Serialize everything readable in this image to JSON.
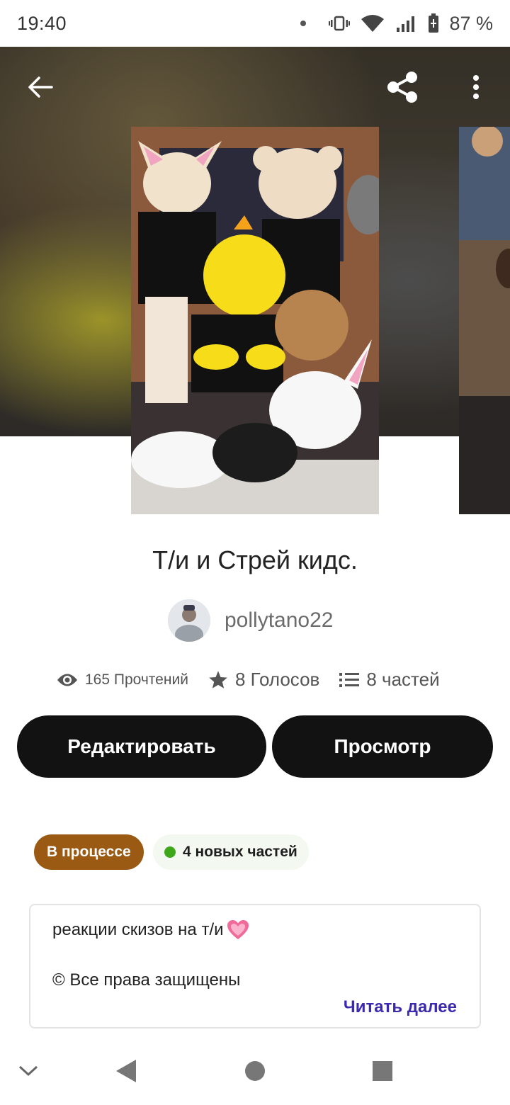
{
  "status_bar": {
    "time": "19:40",
    "battery": "87 %"
  },
  "header": {
    "back_icon": "arrow-left-icon",
    "share_icon": "share-icon",
    "more_icon": "more-vertical-icon"
  },
  "story": {
    "title": "Т/и и Стрей кидс.",
    "author": "pollytano22",
    "stats": {
      "reads": "165 Прочтений",
      "votes": "8 Голосов",
      "parts": "8 частей"
    },
    "buttons": {
      "edit": "Редактировать",
      "view": "Просмотр"
    },
    "tags": {
      "status": "В процессе",
      "new_parts": "4 новых частей"
    },
    "description": {
      "line1": "реакции скизов на т/и",
      "line2": "© Все права защищены",
      "read_more": "Читать далее"
    }
  },
  "colors": {
    "button_bg": "#121212",
    "status_tag": "#9a5a14",
    "new_dot": "#3fa71a",
    "read_more": "#3b2ab0"
  }
}
